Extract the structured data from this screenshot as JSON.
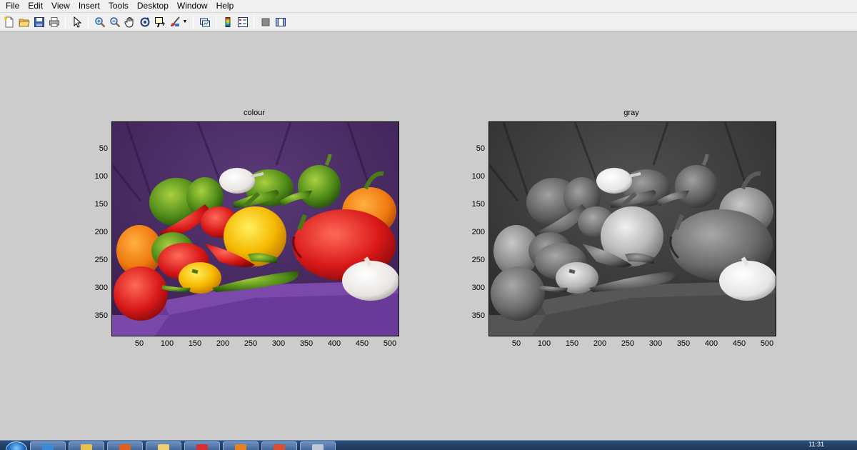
{
  "menu": [
    "File",
    "Edit",
    "View",
    "Insert",
    "Tools",
    "Desktop",
    "Window",
    "Help"
  ],
  "axes": [
    {
      "title": "colour",
      "yticks": [
        "50",
        "100",
        "150",
        "200",
        "250",
        "300",
        "350"
      ],
      "xticks": [
        "50",
        "100",
        "150",
        "200",
        "250",
        "300",
        "350",
        "400",
        "450",
        "500"
      ]
    },
    {
      "title": "gray",
      "yticks": [
        "50",
        "100",
        "150",
        "200",
        "250",
        "300",
        "350"
      ],
      "xticks": [
        "50",
        "100",
        "150",
        "200",
        "250",
        "300",
        "350",
        "400",
        "450",
        "500"
      ]
    }
  ],
  "taskbar": {
    "clock": "11:31",
    "items": [
      "ie-icon",
      "explorer-icon",
      "matlab-icon",
      "folder-icon",
      "chrome-icon",
      "firefox-icon",
      "powerpoint-icon",
      "network-icon"
    ]
  },
  "colors": {
    "figure_bg": "#cccccc",
    "menubar_bg": "#f0f0f0",
    "taskbar": "#2d4f79"
  }
}
